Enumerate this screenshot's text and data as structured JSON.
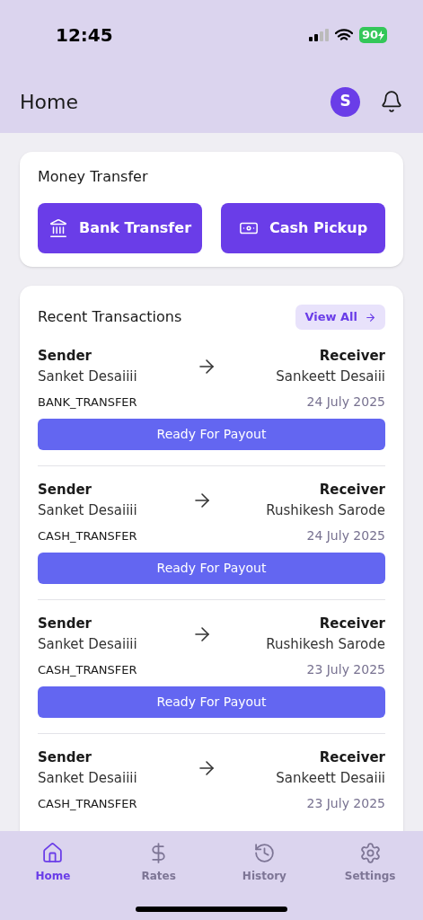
{
  "status_bar": {
    "time": "12:45",
    "battery": "90"
  },
  "header": {
    "title": "Home",
    "avatar_initial": "S"
  },
  "money_transfer": {
    "title": "Money Transfer",
    "actions": [
      {
        "kind": "bank",
        "label": "Bank Transfer"
      },
      {
        "kind": "cash",
        "label": "Cash Pickup"
      }
    ]
  },
  "recent_transactions": {
    "title": "Recent Transactions",
    "view_all": "View All",
    "items": [
      {
        "sender_label": "Sender",
        "sender": "Sanket Desaiiii",
        "receiver_label": "Receiver",
        "receiver": "Sankeett Desaiii",
        "type": "BANK_TRANSFER",
        "date": "24 July 2025",
        "status": "Ready For Payout"
      },
      {
        "sender_label": "Sender",
        "sender": "Sanket Desaiiii",
        "receiver_label": "Receiver",
        "receiver": "Rushikesh Sarode",
        "type": "CASH_TRANSFER",
        "date": "24 July 2025",
        "status": "Ready For Payout"
      },
      {
        "sender_label": "Sender",
        "sender": "Sanket Desaiiii",
        "receiver_label": "Receiver",
        "receiver": "Rushikesh Sarode",
        "type": "CASH_TRANSFER",
        "date": "23 July 2025",
        "status": "Ready For Payout"
      },
      {
        "sender_label": "Sender",
        "sender": "Sanket Desaiiii",
        "receiver_label": "Receiver",
        "receiver": "Sankeett Desaiii",
        "type": "CASH_TRANSFER",
        "date": "23 July 2025"
      }
    ]
  },
  "tab_bar": [
    {
      "kind": "home",
      "label": "Home",
      "selected": true
    },
    {
      "kind": "rates",
      "label": "Rates",
      "selected": false
    },
    {
      "kind": "history",
      "label": "History",
      "selected": false
    },
    {
      "kind": "settings",
      "label": "Settings",
      "selected": false
    }
  ]
}
